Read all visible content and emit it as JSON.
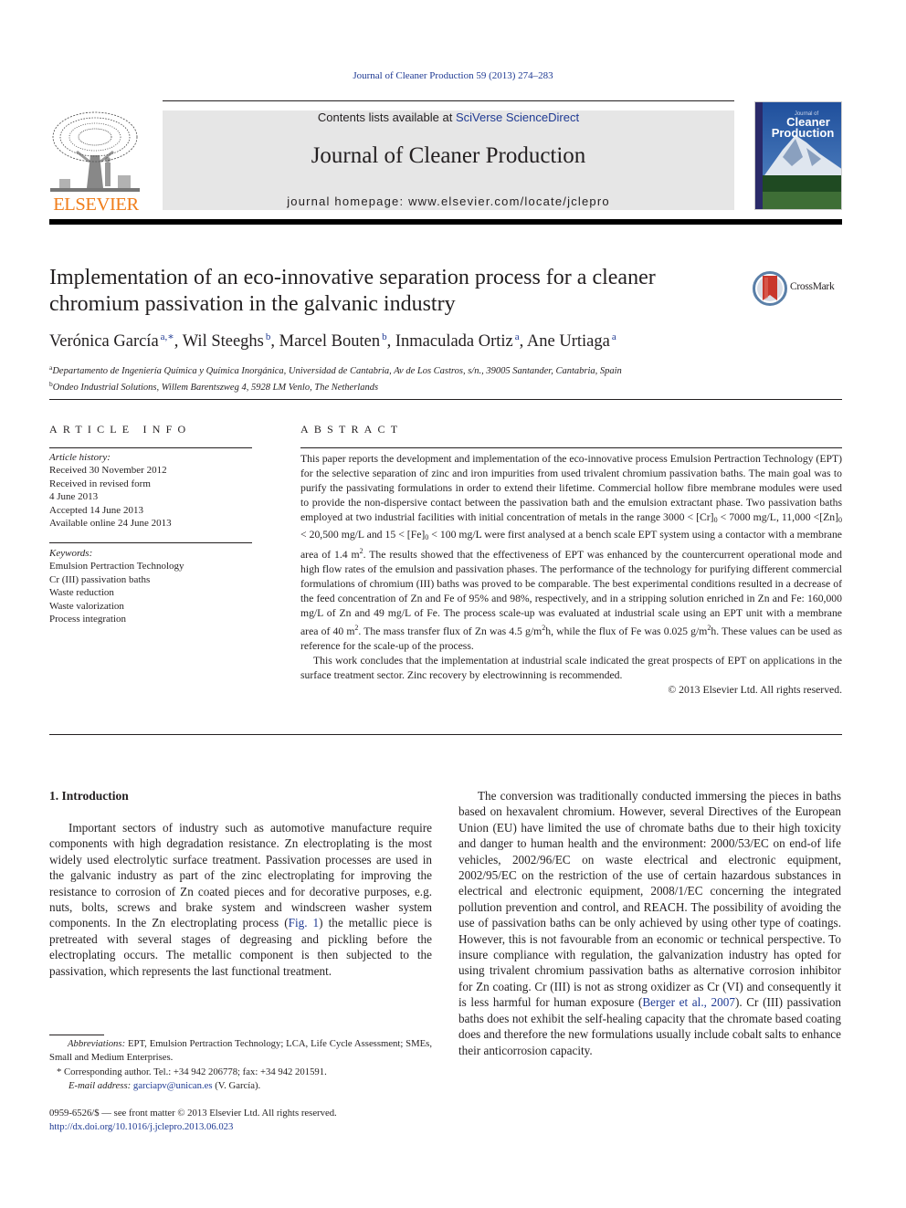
{
  "citation": "Journal of Cleaner Production 59 (2013) 274–283",
  "header": {
    "publisher_logo_text": "ELSEVIER",
    "contents_prefix": "Contents lists available at ",
    "contents_link": "SciVerse ScienceDirect",
    "journal_title": "Journal of Cleaner Production",
    "homepage": "journal homepage: www.elsevier.com/locate/jclepro",
    "cover": {
      "line1": "Journal of",
      "line2": "Cleaner",
      "line3": "Production"
    },
    "colors": {
      "brand_orange": "#f07d1a",
      "link_blue": "#1f3a93",
      "banner_gray": "#e6e6e6"
    }
  },
  "article": {
    "title": "Implementation of an eco-innovative separation process for a cleaner chromium passivation in the galvanic industry",
    "crossmark_label": "CrossMark",
    "authors": [
      {
        "name": "Verónica García",
        "sup": "a,∗",
        "sep": ", "
      },
      {
        "name": "Wil Steeghs",
        "sup": "b",
        "sep": ", "
      },
      {
        "name": "Marcel Bouten",
        "sup": "b",
        "sep": ", "
      },
      {
        "name": "Inmaculada Ortiz",
        "sup": "a",
        "sep": ", "
      },
      {
        "name": "Ane Urtiaga",
        "sup": "a",
        "sep": ""
      }
    ],
    "affiliations": [
      {
        "mark": "a",
        "text": "Departamento de Ingeniería Química y Química Inorgánica, Universidad de Cantabria, Av de Los Castros, s/n., 39005 Santander, Cantabria, Spain"
      },
      {
        "mark": "b",
        "text": "Ondeo Industrial Solutions, Willem Barentszweg 4, 5928 LM Venlo, The Netherlands"
      }
    ]
  },
  "article_info": {
    "heading": "ARTICLE INFO",
    "history_label": "Article history:",
    "history": [
      "Received 30 November 2012",
      "Received in revised form",
      "4 June 2013",
      "Accepted 14 June 2013",
      "Available online 24 June 2013"
    ],
    "keywords_label": "Keywords:",
    "keywords": [
      "Emulsion Pertraction Technology",
      "Cr (III) passivation baths",
      "Waste reduction",
      "Waste valorization",
      "Process integration"
    ]
  },
  "abstract": {
    "heading": "ABSTRACT",
    "p1_a": "This paper reports the development and implementation of the eco-innovative process Emulsion Pertraction Technology (EPT) for the selective separation of zinc and iron impurities from used trivalent chromium passivation baths. The main goal was to purify the passivating formulations in order to extend their lifetime. Commercial hollow fibre membrane modules were used to provide the non-dispersive contact between the passivation bath and the emulsion extractant phase. Two passivation baths employed at two industrial facilities with initial concentration of metals in the range 3000 < [Cr]",
    "p1_b": " < 7000 mg/L, 11,000 <[Zn]",
    "p1_c": " < 20,500 mg/L and 15 < [Fe]",
    "p1_d": " < 100 mg/L were first analysed at a bench scale EPT system using a contactor with a membrane area of 1.4 m",
    "p1_e": ". The results showed that the effectiveness of EPT was enhanced by the countercurrent operational mode and high flow rates of the emulsion and passivation phases. The performance of the technology for purifying different commercial formulations of chromium (III) baths was proved to be comparable. The best experimental conditions resulted in a decrease of the feed concentration of Zn and Fe of 95% and 98%, respectively, and in a stripping solution enriched in Zn and Fe: 160,000 mg/L of Zn and 49 mg/L of Fe. The process scale-up was evaluated at industrial scale using an EPT unit with a membrane area of 40 m",
    "p1_f": ". The mass transfer flux of Zn was 4.5 g/m",
    "p1_g": "h, while the flux of Fe was 0.025 g/m",
    "p1_h": "h. These values can be used as reference for the scale-up of the process.",
    "sub0": "0",
    "sup2": "2",
    "p2": "This work concludes that the implementation at industrial scale indicated the great prospects of EPT on applications in the surface treatment sector. Zinc recovery by electrowinning is recommended.",
    "copyright": "© 2013 Elsevier Ltd. All rights reserved."
  },
  "introduction": {
    "heading": "1.  Introduction",
    "left_p1_a": "Important sectors of industry such as automotive manufacture require components with high degradation resistance. Zn electroplating is the most widely used electrolytic surface treatment. Passivation processes are used in the galvanic industry as part of the zinc electroplating for improving the resistance to corrosion of Zn coated pieces and for decorative purposes, e.g. nuts, bolts, screws and brake system and windscreen washer system components. In the Zn electroplating process (",
    "left_p1_link": "Fig. 1",
    "left_p1_b": ") the metallic piece is pretreated with several stages of degreasing and pickling before the electroplating occurs. The metallic component is then subjected to the passivation, which represents the last functional treatment.",
    "right_p1_a": "The conversion was traditionally conducted immersing the pieces in baths based on hexavalent chromium. However, several Directives of the European Union (EU) have limited the use of chromate baths due to their high toxicity and danger to human health and the environment: 2000/53/EC on end-of life vehicles, 2002/96/EC on waste electrical and electronic equipment, 2002/95/EC on the restriction of the use of certain hazardous substances in electrical and electronic equipment, 2008/1/EC concerning the integrated pollution prevention and control, and REACH. The possibility of avoiding the use of passivation baths can be only achieved by using other type of coatings. However, this is not favourable from an economic or technical perspective. To insure compliance with regulation, the galvanization industry has opted for using trivalent chromium passivation baths as alternative corrosion inhibitor for Zn coating. Cr (III) is not as strong oxidizer as Cr (VI) and consequently it is less harmful for human exposure (",
    "right_p1_link": "Berger et al., 2007",
    "right_p1_b": "). Cr (III) passivation baths does not exhibit the self-healing capacity that the chromate based coating does and therefore the new formulations usually include cobalt salts to enhance their anticorrosion capacity."
  },
  "footnotes": {
    "abbrev_label": "Abbreviations:",
    "abbrev_text": " EPT, Emulsion Pertraction Technology; LCA, Life Cycle Assessment; SMEs, Small and Medium Enterprises.",
    "corr_mark": "*",
    "corr_text": " Corresponding author. Tel.: +34 942 206778; fax: +34 942 201591.",
    "email_label": "E-mail address:",
    "email": "garciapv@unican.es",
    "email_suffix": " (V. García)."
  },
  "front_matter": {
    "issn_line": "0959-6526/$ — see front matter © 2013 Elsevier Ltd. All rights reserved.",
    "doi": "http://dx.doi.org/10.1016/j.jclepro.2013.06.023"
  }
}
